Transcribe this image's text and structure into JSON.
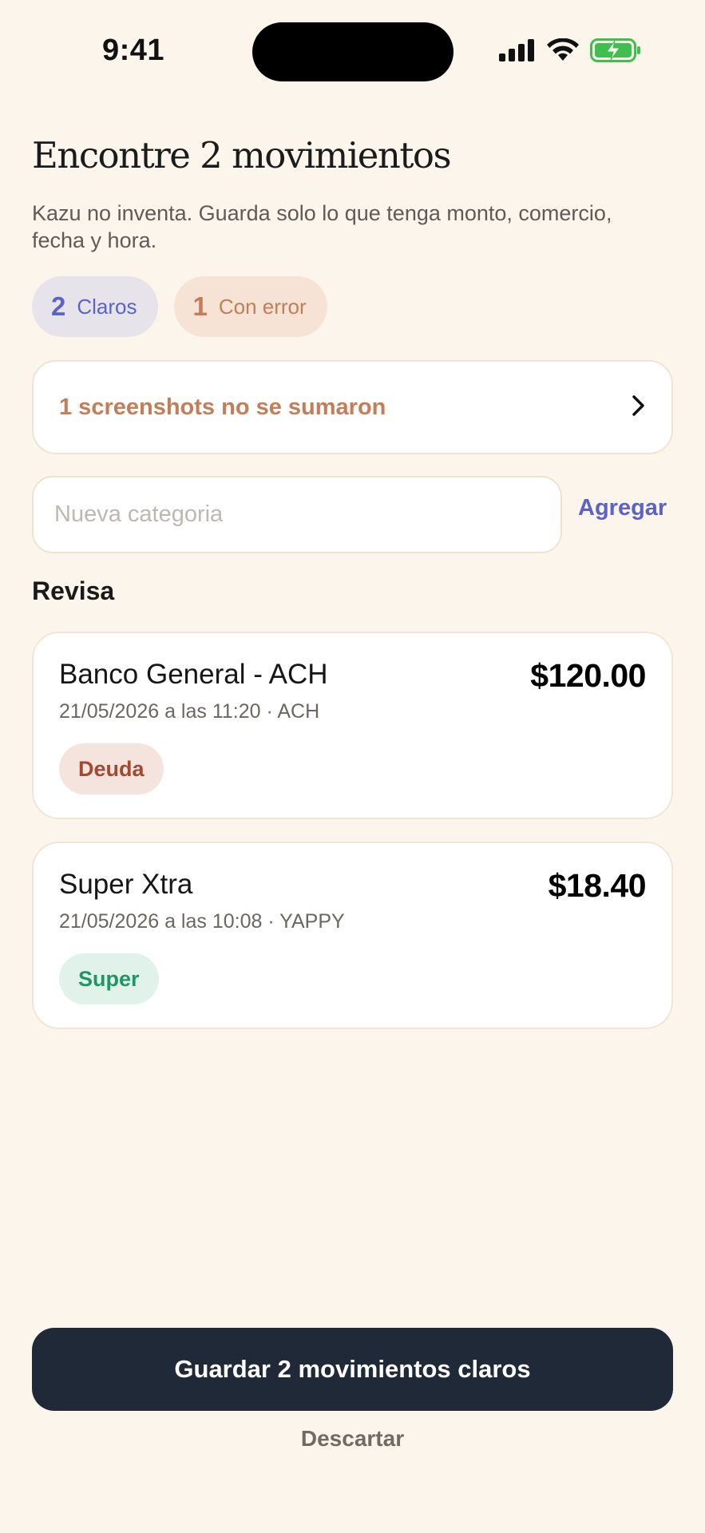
{
  "status_bar": {
    "time": "9:41",
    "icons": [
      "signal-icon",
      "wifi-icon",
      "battery-charging-icon"
    ],
    "battery_color": "#3fbf4f"
  },
  "header": {
    "title": "Encontre 2 movimientos",
    "subtitle": "Kazu no inventa. Guarda solo lo que tenga monto, comercio, fecha y hora."
  },
  "pills": {
    "clear": {
      "count": "2",
      "label": "Claros"
    },
    "error": {
      "count": "1",
      "label": "Con error"
    }
  },
  "warning": {
    "text": "1 screenshots no se sumaron",
    "icon": "chevron-right-icon"
  },
  "category": {
    "placeholder": "Nueva categoria",
    "value": "",
    "add_label": "Agregar"
  },
  "section_label": "Revisa",
  "transactions": [
    {
      "merchant": "Banco General - ACH",
      "amount": "$120.00",
      "meta": "21/05/2026 a las 11:20 · ACH",
      "tag": "Deuda"
    },
    {
      "merchant": "Super Xtra",
      "amount": "$18.40",
      "meta": "21/05/2026 a las 10:08 · YAPPY",
      "tag": "Super"
    }
  ],
  "actions": {
    "save_label": "Guardar 2 movimientos claros",
    "discard_label": "Descartar"
  },
  "colors": {
    "background": "#fbf5ec",
    "accent": "#5b63c9",
    "warning": "#c57d58",
    "primary_button": "#202938"
  }
}
